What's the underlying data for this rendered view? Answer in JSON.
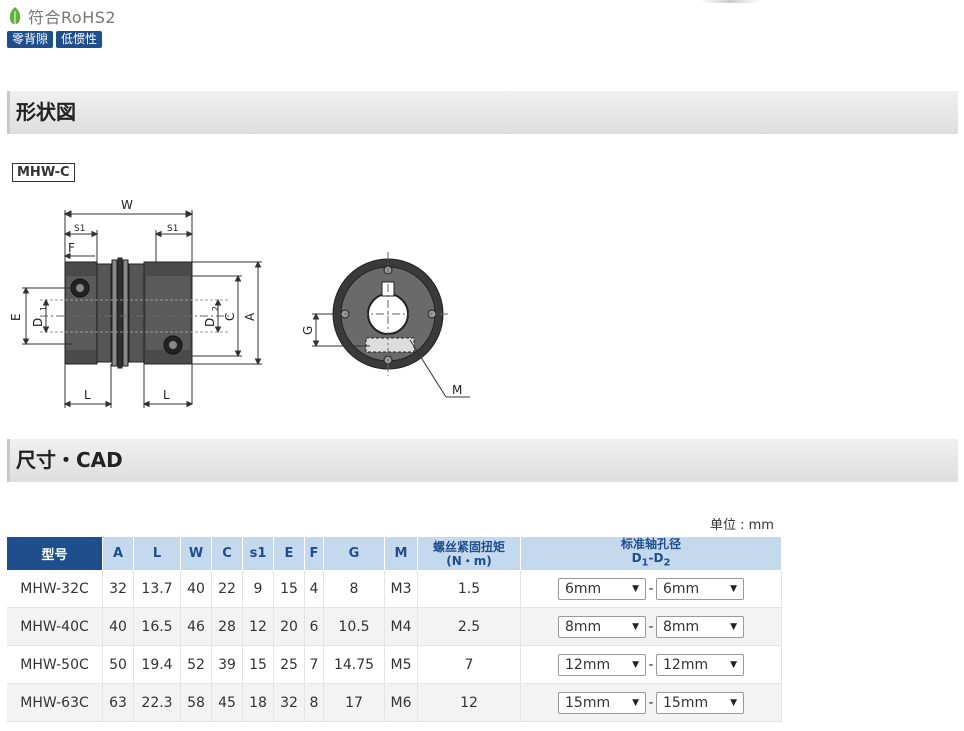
{
  "badges": {
    "rohs": "符合RoHS2",
    "tags": [
      "零背隙",
      "低惯性"
    ]
  },
  "sections": {
    "shape": "形状図",
    "dimensions": "尺寸・CAD"
  },
  "model_label": "MHW-C",
  "drawing_labels": {
    "W": "W",
    "S1a": "S1",
    "S1b": "S1",
    "F": "F",
    "E": "E",
    "D1": "D",
    "D1_sub": "1",
    "D2": "D",
    "D2_sub": "2",
    "C": "C",
    "A": "A",
    "La": "L",
    "Lb": "L",
    "G": "G",
    "M": "M"
  },
  "unit": "单位 : mm",
  "table": {
    "headers": [
      "型号",
      "A",
      "L",
      "W",
      "C",
      "s1",
      "E",
      "F",
      "G",
      "M"
    ],
    "torque_header": "螺丝紧固扭矩",
    "torque_unit": "(N・m)",
    "bore_header": "标准轴孔径",
    "bore_sub": "D",
    "bore_sub1": "1",
    "bore_dash": "-D",
    "bore_sub2": "2",
    "rows": [
      {
        "model": "MHW-32C",
        "A": "32",
        "L": "13.7",
        "W": "40",
        "C": "22",
        "s1": "9",
        "E": "15",
        "F": "4",
        "G": "8",
        "M": "M3",
        "torque": "1.5",
        "d1": "6mm",
        "d2": "6mm"
      },
      {
        "model": "MHW-40C",
        "A": "40",
        "L": "16.5",
        "W": "46",
        "C": "28",
        "s1": "12",
        "E": "20",
        "F": "6",
        "G": "10.5",
        "M": "M4",
        "torque": "2.5",
        "d1": "8mm",
        "d2": "8mm"
      },
      {
        "model": "MHW-50C",
        "A": "50",
        "L": "19.4",
        "W": "52",
        "C": "39",
        "s1": "15",
        "E": "25",
        "F": "7",
        "G": "14.75",
        "M": "M5",
        "torque": "7",
        "d1": "12mm",
        "d2": "12mm"
      },
      {
        "model": "MHW-63C",
        "A": "63",
        "L": "22.3",
        "W": "58",
        "C": "45",
        "s1": "18",
        "E": "32",
        "F": "8",
        "G": "17",
        "M": "M6",
        "torque": "12",
        "d1": "15mm",
        "d2": "15mm"
      }
    ],
    "separator": "-"
  }
}
